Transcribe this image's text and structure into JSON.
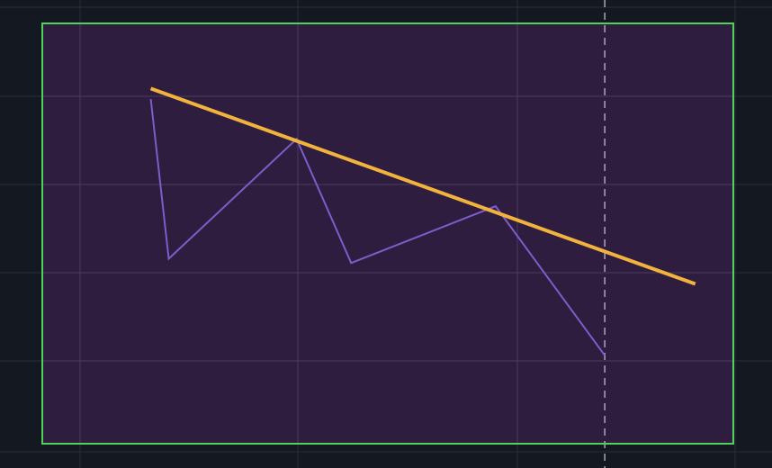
{
  "colors": {
    "background": "#131821",
    "plot_area": "#2f1d40",
    "grid": "#4a3d5e",
    "outer_grid": "#2a2f3a",
    "border": "#4fd15a",
    "price_line": "#7e5cc9",
    "trend_line": "#f2b33d",
    "cursor_line": "#a8a8b8"
  },
  "chart_data": {
    "type": "line",
    "xlim": [
      0,
      100
    ],
    "ylim": [
      0,
      100
    ],
    "grid": true,
    "legend": "none",
    "series": [
      {
        "role": "price",
        "x": [
          15.7,
          18.3,
          36.8,
          44.7,
          65.6,
          81.4
        ],
        "y": [
          82,
          44,
          72.5,
          43,
          56.5,
          21
        ]
      },
      {
        "role": "trendline",
        "x": [
          15.7,
          94.5
        ],
        "y": [
          84.5,
          38
        ]
      }
    ],
    "cursor": {
      "x": 81.4
    }
  }
}
